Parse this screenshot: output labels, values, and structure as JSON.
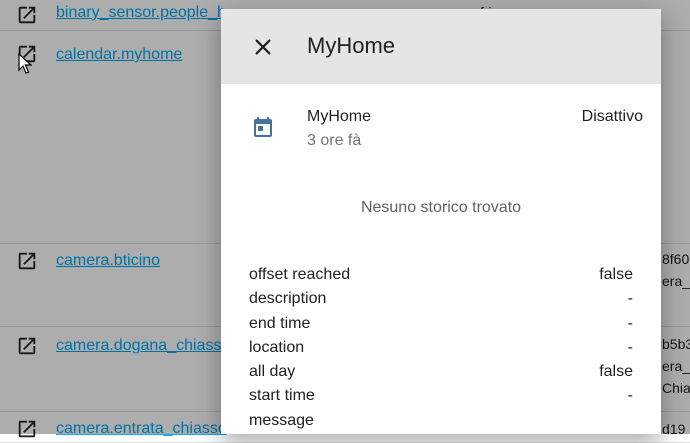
{
  "background_rows": [
    {
      "entity": "binary_sensor.people_h",
      "right": "",
      "mid": "frig..."
    },
    {
      "entity": "calendar.myhome",
      "right": "",
      "mid": ""
    },
    {
      "entity": "camera.bticino",
      "right": "8f60",
      "right2": "era_",
      "mid": ""
    },
    {
      "entity": "camera.dogana_chiasso",
      "right": "b5b3",
      "right2": "era_",
      "right3": "Chia",
      "mid": ""
    },
    {
      "entity": "camera.entrata_chiasso",
      "right": "d19",
      "mid": ""
    }
  ],
  "dialog": {
    "title": "MyHome",
    "entity_name": "MyHome",
    "last_changed": "3 ore fà",
    "state": "Disattivo",
    "no_history": "Nesuno storico trovato",
    "attributes": [
      {
        "key": "offset reached",
        "value": "false"
      },
      {
        "key": "description",
        "value": "-"
      },
      {
        "key": "end time",
        "value": "-"
      },
      {
        "key": "location",
        "value": "-"
      },
      {
        "key": "all day",
        "value": "false"
      },
      {
        "key": "start time",
        "value": "-"
      },
      {
        "key": "message",
        "value": ""
      }
    ]
  },
  "colors": {
    "accent_link": "#03a9f4",
    "calendar_icon": "#44739e",
    "header_bg": "#e5e5e5"
  }
}
